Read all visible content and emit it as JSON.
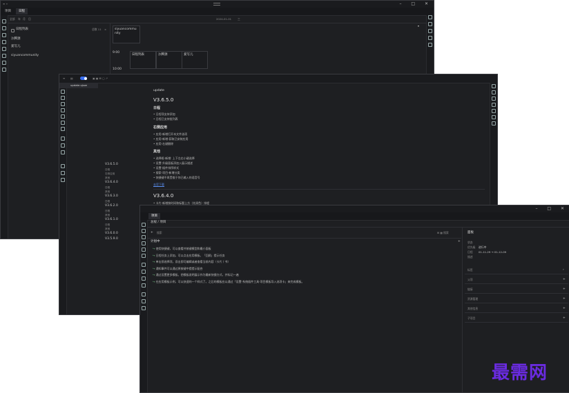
{
  "winA": {
    "tabs": [
      "项目",
      "日程"
    ],
    "toolbar": [
      "全部",
      "年",
      "月",
      "日"
    ],
    "date": "2024-01-01",
    "date_flag": "三",
    "list_header": "日程列表",
    "list_right": "总数 11",
    "list_right2": "×",
    "items": [
      "沙腾源",
      "爱写儿",
      "siyuancommunity"
    ],
    "cell_top": "siyuancommunity",
    "time1": "9:00",
    "time2": "10:00",
    "slots": [
      "日程列表",
      "沙腾源",
      "爱写儿"
    ]
  },
  "winB": {
    "tab": "update.sjson",
    "versions": [
      "V3.6.5.0",
      "日程",
      "右侧应用",
      "其他",
      "V3.6.4.0",
      "日程",
      "其他",
      "V3.6.3.0",
      "日程",
      "V3.6.2.0",
      "日程",
      "其他",
      "V3.6.1.0",
      "日程",
      "其他",
      "V3.6.0.0",
      "V3.5.9.0"
    ],
    "update_title": "update",
    "v1": "V3.6.5.0",
    "sec1": "日程",
    "sec1_items": [
      "日程项支持添加",
      "日程已支持批列表"
    ],
    "sec2": "右侧应用",
    "sec2_items": [
      "应用-新增打开本文件选项",
      "应用-新增-获取已安装应用",
      "应用-右键删除"
    ],
    "sec3": "其他",
    "sec3_items": [
      "选择框-新增: 上下左右小键选择",
      "设置-升级面板添加入展示描述",
      "设置-插件排序样式",
      "搜索-项目-新增分类",
      "快捷键不再受限于你已输入的语音号"
    ],
    "link": "去官下载",
    "v2": "V3.6.4.0",
    "v2_item": "卡片-新增按时间和标题上方（先润色）排程"
  },
  "winC": {
    "tab": "项目",
    "breadcrumb": "总规 / 项目",
    "add": "+",
    "search": "搜索",
    "section": "计划中",
    "add2": "+",
    "tasks": [
      "使用快捷键，可以查看并按键模型和最小面板",
      "日程任务上添加，可以点击应用模板，「回顾」提示任务",
      "单击即选择项，双击即可编辑或者查看当前内容（卡片 / 书）",
      "通知事件可以通过原按键中提提示配合",
      "通过设置更多模板，把模板说明展示作为最新快捷方式，并标记一遍",
      "在应用模板示例，可以快速的一个样式了。之后的模板应以通过「设置-系统插件工具-项目模板导入选项卡」来完成模板。"
    ],
    "panel_title": "面板",
    "fields": [
      "状态",
      "优先级",
      "日程",
      "描述"
    ],
    "status_val": "进行中",
    "date_range": "01-11-29 → 01-12-09",
    "groups": [
      "标签",
      "父项",
      "链接",
      "资源管理",
      "其他信息",
      "子项目"
    ]
  },
  "watermark": "最需网"
}
